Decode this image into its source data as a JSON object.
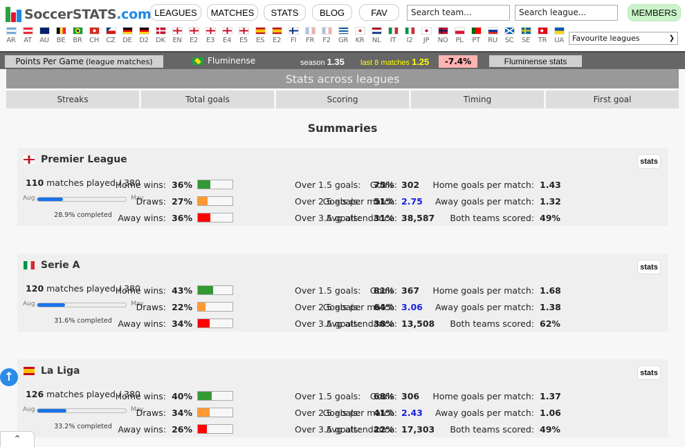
{
  "header": {
    "logo": {
      "text_main": "SoccerSTATS",
      "text_tld": ".com",
      "bar_colors": [
        "#2ea043",
        "#e8142d",
        "#1e88e5"
      ]
    },
    "nav": [
      "LEAGUES",
      "MATCHES",
      "STATS",
      "BLOG",
      "FAV"
    ],
    "search_team_placeholder": "Search team...",
    "search_league_placeholder": "Search league...",
    "members_label": "MEMBERS",
    "favourite_select": "Favourite leagues"
  },
  "flags": [
    {
      "code": "AR",
      "icon": "argentina-flag-icon"
    },
    {
      "code": "AT",
      "icon": "austria-flag-icon"
    },
    {
      "code": "AU",
      "icon": "australia-flag-icon"
    },
    {
      "code": "BE",
      "icon": "belgium-flag-icon"
    },
    {
      "code": "BR",
      "icon": "brazil-flag-icon"
    },
    {
      "code": "CH",
      "icon": "switzerland-flag-icon"
    },
    {
      "code": "CZ",
      "icon": "czech-flag-icon"
    },
    {
      "code": "DE",
      "icon": "germany-flag-icon"
    },
    {
      "code": "D2",
      "icon": "germany-flag-icon"
    },
    {
      "code": "DK",
      "icon": "denmark-flag-icon"
    },
    {
      "code": "EN",
      "icon": "england-flag-icon"
    },
    {
      "code": "E2",
      "icon": "england-flag-icon"
    },
    {
      "code": "E3",
      "icon": "england-flag-icon"
    },
    {
      "code": "E4",
      "icon": "england-flag-icon"
    },
    {
      "code": "E5",
      "icon": "england-flag-icon"
    },
    {
      "code": "ES",
      "icon": "spain-flag-icon"
    },
    {
      "code": "E2",
      "icon": "spain-flag-icon"
    },
    {
      "code": "FI",
      "icon": "finland-flag-icon"
    },
    {
      "code": "FR",
      "icon": "france-flag-icon"
    },
    {
      "code": "F2",
      "icon": "france-flag-icon"
    },
    {
      "code": "GR",
      "icon": "greece-flag-icon"
    },
    {
      "code": "KR",
      "icon": "south-korea-flag-icon"
    },
    {
      "code": "NL",
      "icon": "netherlands-flag-icon"
    },
    {
      "code": "IT",
      "icon": "italy-flag-icon"
    },
    {
      "code": "I2",
      "icon": "italy-flag-icon"
    },
    {
      "code": "JP",
      "icon": "japan-flag-icon"
    },
    {
      "code": "NO",
      "icon": "norway-flag-icon"
    },
    {
      "code": "PL",
      "icon": "poland-flag-icon"
    },
    {
      "code": "PT",
      "icon": "portugal-flag-icon"
    },
    {
      "code": "RU",
      "icon": "russia-flag-icon"
    },
    {
      "code": "SC",
      "icon": "scotland-flag-icon"
    },
    {
      "code": "SE",
      "icon": "sweden-flag-icon"
    },
    {
      "code": "TR",
      "icon": "turkey-flag-icon"
    },
    {
      "code": "UA",
      "icon": "ukraine-flag-icon"
    }
  ],
  "teambar": {
    "ppg_label": "Points Per Game",
    "ppg_sub": "(league matches)",
    "team": "Fluminense",
    "season_label": "season",
    "season_value": "1.35",
    "last8_label": "last 8 matches",
    "last8_value": "1.25",
    "change": "-7.4%",
    "team_stats_label": "Fluminense stats"
  },
  "section_title": "Stats across leagues",
  "tabs": [
    "Streaks",
    "Total goals",
    "Scoring",
    "Timing",
    "First goal"
  ],
  "summaries_title": "Summaries",
  "labels": {
    "played_suffix": "matches played / ",
    "aug": "Aug",
    "may": "May",
    "completed_suffix": " completed",
    "home_wins": "Home wins:",
    "draws": "Draws:",
    "away_wins": "Away wins:",
    "over15": "Over 1.5 goals:",
    "over25": "Over 2.5 goals:",
    "over35": "Over 3.5 goals:",
    "goals": "Goals:",
    "gpm": "Goals per match:",
    "attendance": "Avg attendance:",
    "home_gpm": "Home goals per match:",
    "away_gpm": "Away goals per match:",
    "btts": "Both teams scored:",
    "stats_btn": "stats"
  },
  "colors": {
    "home": "#339933",
    "draw": "#ff9933",
    "away": "#ff0000",
    "season_fill": "#1a73e8",
    "gpm": "#1a22e0"
  },
  "leagues": [
    {
      "name": "Premier League",
      "flag": "england-flag-icon",
      "played": "110",
      "total": "380",
      "completed": "28.9%",
      "completed_frac": 0.289,
      "home_wins": "36%",
      "home_frac": 0.36,
      "draws": "27%",
      "draw_frac": 0.27,
      "away_wins": "36%",
      "away_frac": 0.36,
      "over15": "75%",
      "over25": "51%",
      "over35": "31%",
      "goals": "302",
      "gpm": "2.75",
      "attendance": "38,587",
      "home_gpm": "1.43",
      "away_gpm": "1.32",
      "btts": "49%"
    },
    {
      "name": "Serie A",
      "flag": "italy-flag-icon",
      "played": "120",
      "total": "380",
      "completed": "31.6%",
      "completed_frac": 0.316,
      "home_wins": "43%",
      "home_frac": 0.43,
      "draws": "22%",
      "draw_frac": 0.22,
      "away_wins": "34%",
      "away_frac": 0.34,
      "over15": "81%",
      "over25": "64%",
      "over35": "38%",
      "goals": "367",
      "gpm": "3.06",
      "attendance": "13,508",
      "home_gpm": "1.68",
      "away_gpm": "1.38",
      "btts": "62%"
    },
    {
      "name": "La Liga",
      "flag": "spain-flag-icon",
      "played": "126",
      "total": "380",
      "completed": "33.2%",
      "completed_frac": 0.332,
      "home_wins": "40%",
      "home_frac": 0.4,
      "draws": "34%",
      "draw_frac": 0.34,
      "away_wins": "26%",
      "away_frac": 0.26,
      "over15": "68%",
      "over25": "41%",
      "over35": "22%",
      "goals": "306",
      "gpm": "2.43",
      "attendance": "17,303",
      "home_gpm": "1.37",
      "away_gpm": "1.06",
      "btts": "49%"
    }
  ]
}
